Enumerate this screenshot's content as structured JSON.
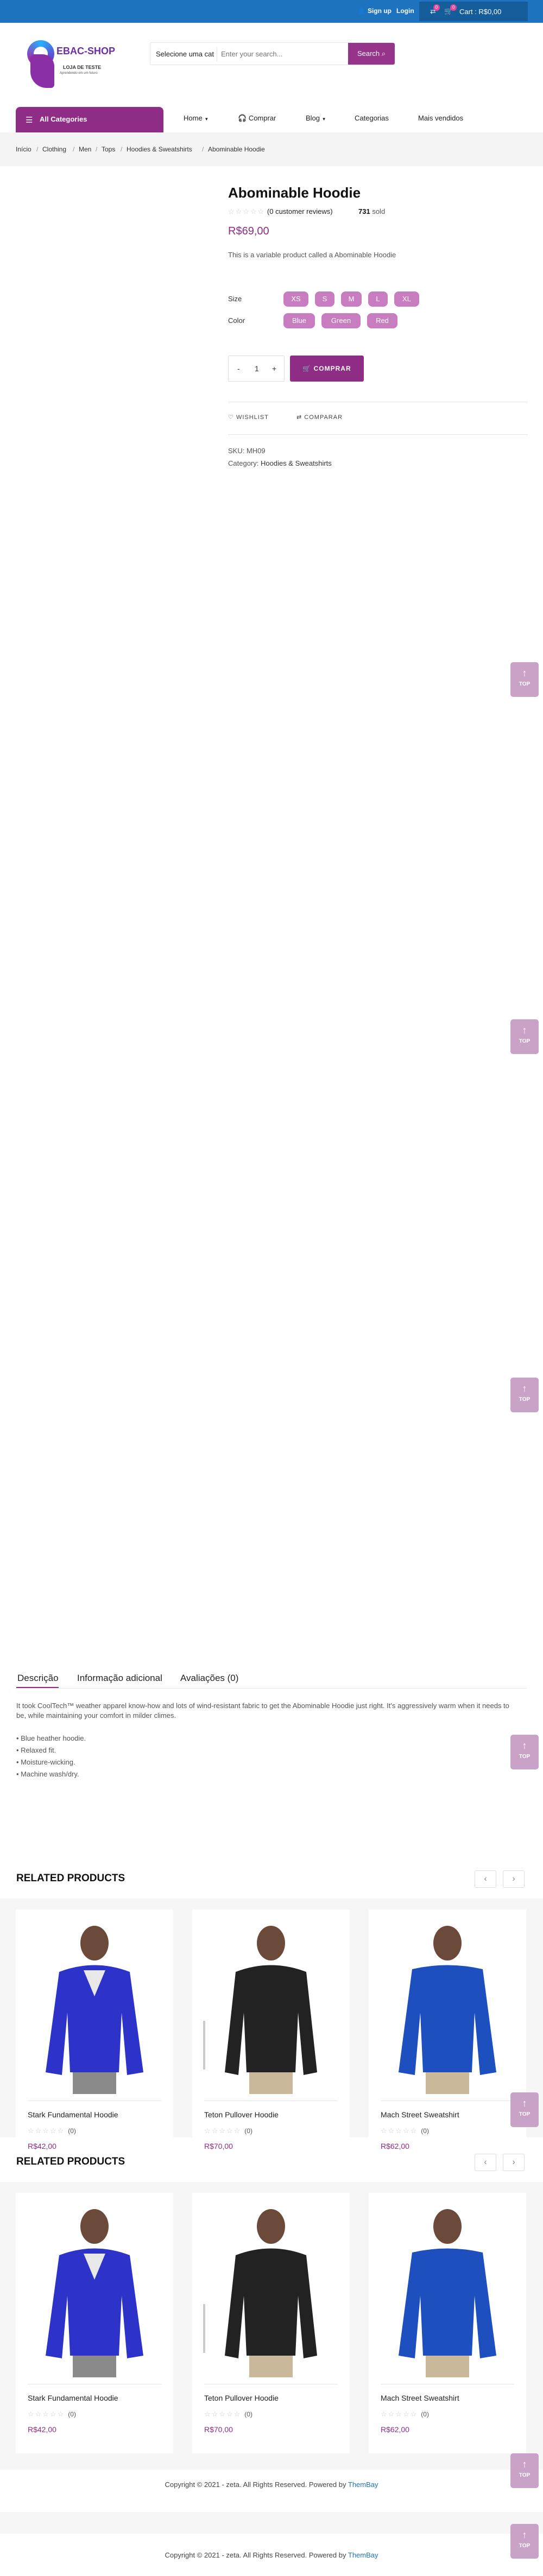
{
  "topbar": {
    "signup": "Sign up",
    "login": "Login",
    "cart_label": "Cart : R$0,00",
    "compare_count": "0",
    "cart_count": "0"
  },
  "header": {
    "logo_name": "EBAC-SHOP",
    "logo_sub": "LOJA DE TESTE",
    "logo_tagline": "Aprendendo em um futuro",
    "search_category": "Selecione uma cat",
    "search_placeholder": "Enter your search...",
    "search_button": "Search"
  },
  "nav": {
    "all_categories": "All Categories",
    "items": [
      "Home",
      "Comprar",
      "Blog",
      "Categorias",
      "Mais vendidos"
    ]
  },
  "breadcrumb": [
    "Início",
    "Clothing",
    "Men",
    "Tops",
    "Hoodies & Sweatshirts",
    "Abominable Hoodie"
  ],
  "product": {
    "title": "Abominable Hoodie",
    "reviews": "(0 customer reviews)",
    "sold_num": "731",
    "sold_label": "sold",
    "price": "R$69,00",
    "short_desc": "This is a variable product called a Abominable Hoodie",
    "size_label": "Size",
    "sizes": [
      "XS",
      "S",
      "M",
      "L",
      "XL"
    ],
    "color_label": "Color",
    "colors": [
      "Blue",
      "Green",
      "Red"
    ],
    "qty": "1",
    "qty_minus": "-",
    "qty_plus": "+",
    "add_button": "COMPRAR",
    "wishlist": "WISHLIST",
    "compare": "COMPARAR",
    "sku_label": "SKU:",
    "sku": "MH09",
    "category_label": "Category:",
    "category": "Hoodies & Sweatshirts"
  },
  "scroll_top_label": "TOP",
  "tabs": {
    "labels": [
      "Descrição",
      "Informação adicional",
      "Avaliações (0)"
    ],
    "description": "It took CoolTech™ weather apparel know-how and lots of wind-resistant fabric to get the Abominable Hoodie just right. It's aggressively warm when it needs to be, while maintaining your comfort in milder climes.",
    "bullets": [
      "• Blue heather hoodie.",
      "• Relaxed fit.",
      "• Moisture-wicking.",
      "• Machine wash/dry."
    ]
  },
  "related": {
    "title": "RELATED PRODUCTS",
    "prev": "‹",
    "next": "›",
    "products": [
      {
        "name": "Stark Fundamental Hoodie",
        "reviews": "(0)",
        "price": "R$42,00"
      },
      {
        "name": "Teton Pullover Hoodie",
        "reviews": "(0)",
        "price": "R$70,00"
      },
      {
        "name": "Mach Street Sweatshirt",
        "reviews": "(0)",
        "price": "R$62,00"
      }
    ]
  },
  "footer": {
    "copyright": "Copyright © 2021 - zeta. All Rights Reserved. Powered by",
    "powered": "ThemBay"
  },
  "colors": {
    "accent": "#8f2c86",
    "topbar": "#1e73be",
    "chip": "#c87dc0"
  }
}
